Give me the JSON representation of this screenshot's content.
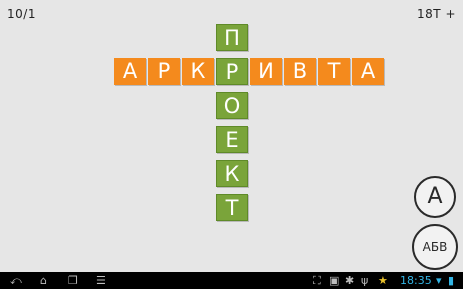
{
  "hud": {
    "level": "10/1",
    "coins": "18T +"
  },
  "puzzle": {
    "horizontal_word": [
      "А",
      "Р",
      "К",
      "Р",
      "И",
      "В",
      "Т",
      "А"
    ],
    "vertical_word": [
      "П",
      "Р",
      "О",
      "Е",
      "К",
      "Т"
    ],
    "horizontal_color": "#f48a1d",
    "vertical_color": "#7aa43a"
  },
  "buttons": {
    "hint_letter": "А",
    "hint_word": "АБВ"
  },
  "statusbar": {
    "time": "18:35",
    "icons": [
      "back-icon",
      "home-icon",
      "recent-apps-icon",
      "menu-icon",
      "screenshot-icon",
      "gallery-icon",
      "android-debug-icon",
      "usb-icon",
      "star-icon",
      "wifi-icon",
      "battery-icon"
    ]
  }
}
